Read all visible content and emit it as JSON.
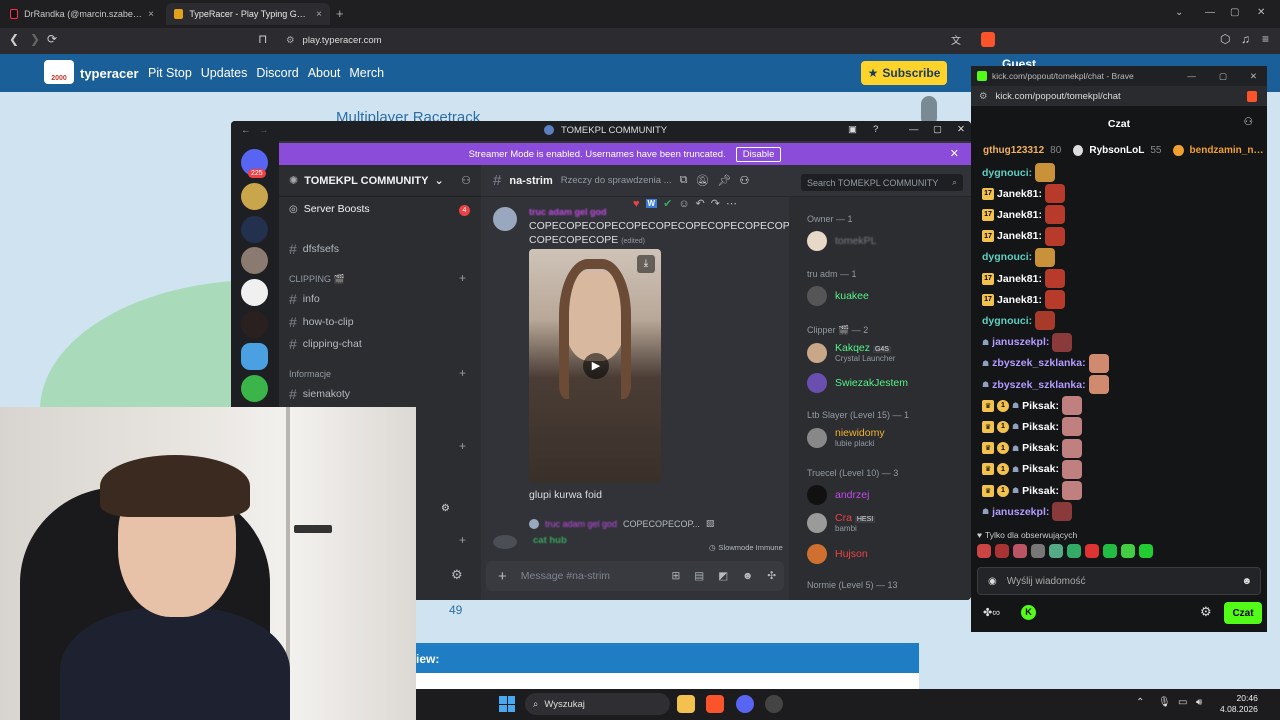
{
  "browser": {
    "tabs": [
      {
        "label": "DrRandka (@marcin.szabelski) | TikTo",
        "active": false
      },
      {
        "label": "TypeRacer - Play Typing Games",
        "active": true
      }
    ],
    "url": "play.typeracer.com"
  },
  "typeracer": {
    "brand": "typeracer",
    "logo_text": "2000",
    "menu": [
      "Pit Stop",
      "Updates",
      "Discord",
      "About",
      "Merch"
    ],
    "subscribe": "Subscribe",
    "guest": "Guest",
    "race_title": "Multiplayer Racetrack",
    "count": "49",
    "review_label": "iew:"
  },
  "discord": {
    "title": "TOMEKPL COMMUNITY",
    "streamer_msg": "Streamer Mode is enabled. Usernames have been truncated.",
    "disable": "Disable",
    "guild_badge": "225",
    "server_name": "TOMEKPL COMMUNITY",
    "server_boosts": "Server Boosts",
    "boost_count": "4",
    "channels": [
      {
        "name": "dfsfsefs"
      },
      {
        "category": "CLIPPING 🎬"
      },
      {
        "name": "info"
      },
      {
        "name": "how-to-clip"
      },
      {
        "name": "clipping-chat"
      },
      {
        "category": "Informacje"
      },
      {
        "name": "siemakoty"
      }
    ],
    "chat_channel": "na-strim",
    "topic": "Rzeczy do sprawdzenia ...",
    "search_placeholder": "Search TOMEKPL COMMUNITY",
    "message": {
      "author": "truc adam gel god",
      "text": "COPECOPECOPECOPECOPECOPECOPECOPECOPE COPECOPECOPE",
      "edited": "(edited)",
      "caption": "glupi kurwa foid"
    },
    "reply_preview": "COPECOPECOP...",
    "reply_user": "cat hub",
    "slowmode": "Slowmode Immune",
    "input_placeholder": "Message #na-strim",
    "member_groups": [
      {
        "title": "Owner — 1",
        "members": [
          {
            "name": "tomekPL",
            "sub": "",
            "color": "#7a7d83"
          }
        ]
      },
      {
        "title": "tru adm — 1",
        "members": [
          {
            "name": "kuakee",
            "sub": "",
            "color": "#57f287"
          }
        ]
      },
      {
        "title": "Clipper 🎬 — 2",
        "members": [
          {
            "name": "Kakqez",
            "tag": "G4S",
            "sub": "Crystal Launcher",
            "color": "#57f287"
          },
          {
            "name": "SwiezakJestem",
            "sub": "",
            "color": "#57f287"
          }
        ]
      },
      {
        "title": "Ltb Slayer (Level 15) — 1",
        "members": [
          {
            "name": "niewidomy",
            "sub": "lubie placki",
            "color": "#f0b232"
          }
        ]
      },
      {
        "title": "Truecel (Level 10) — 3",
        "members": [
          {
            "name": "andrzej",
            "sub": "",
            "color": "#c34be6"
          },
          {
            "name": "Cra",
            "tag": "HESI",
            "sub": "bambi",
            "color": "#ed4245"
          },
          {
            "name": "Hujson",
            "sub": "",
            "color": "#ed4245"
          }
        ]
      },
      {
        "title": "Normie (Level 5) — 13",
        "members": []
      }
    ]
  },
  "kick": {
    "window_title": "kick.com/popout/tomekpl/chat - Brave",
    "url": "kick.com/popout/tomekpl/chat",
    "header": "Czat",
    "top_users": [
      {
        "name": "gthug123312",
        "count": "80"
      },
      {
        "name": "RybsonLoL",
        "count": "55"
      },
      {
        "name": "bendzamin_netan",
        "count": ""
      }
    ],
    "messages": [
      {
        "user": "dygnouci:",
        "color": "#5ecfc1",
        "badges": 0
      },
      {
        "user": "Janek81:",
        "color": "#ffffff",
        "badges": 1
      },
      {
        "user": "Janek81:",
        "color": "#ffffff",
        "badges": 1
      },
      {
        "user": "Janek81:",
        "color": "#ffffff",
        "badges": 1
      },
      {
        "user": "dygnouci:",
        "color": "#5ecfc1",
        "badges": 0
      },
      {
        "user": "Janek81:",
        "color": "#ffffff",
        "badges": 1
      },
      {
        "user": "Janek81:",
        "color": "#ffffff",
        "badges": 1
      },
      {
        "user": "dygnouci:",
        "color": "#5ecfc1",
        "badges": 0
      },
      {
        "user": "januszekpl:",
        "color": "#b39cff",
        "badges": 0
      },
      {
        "user": "zbyszek_szklanka:",
        "color": "#b39cff",
        "badges": 0
      },
      {
        "user": "zbyszek_szklanka:",
        "color": "#b39cff",
        "badges": 0
      },
      {
        "user": "Piksak:",
        "color": "#ffffff",
        "badges": 2
      },
      {
        "user": "Piksak:",
        "color": "#ffffff",
        "badges": 2
      },
      {
        "user": "Piksak:",
        "color": "#ffffff",
        "badges": 2
      },
      {
        "user": "Piksak:",
        "color": "#ffffff",
        "badges": 2
      },
      {
        "user": "Piksak:",
        "color": "#ffffff",
        "badges": 2
      },
      {
        "user": "januszekpl:",
        "color": "#b39cff",
        "badges": 0
      }
    ],
    "followers_only": "Tylko dla obserwujących",
    "input_placeholder": "Wyślij wiadomość",
    "send": "Czat"
  },
  "taskbar": {
    "search": "Wyszukaj",
    "time": "20:46",
    "date": "4.08.2026"
  },
  "colors": {
    "typeracer_nav": "#1b5f99",
    "discord_accent": "#8a4cd9",
    "kick_green": "#53fc18"
  }
}
